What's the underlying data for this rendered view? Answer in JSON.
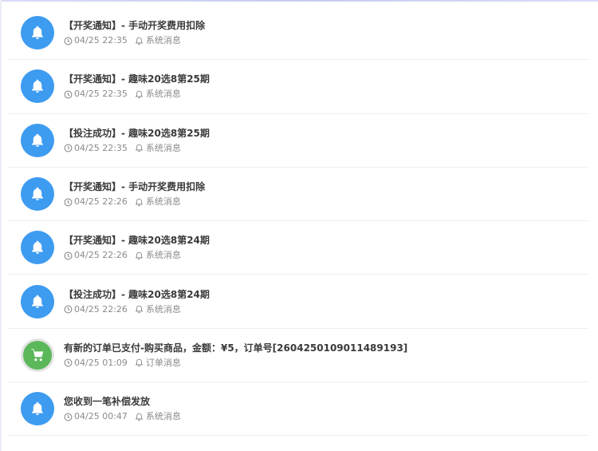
{
  "notifications": [
    {
      "title": "【开奖通知】- 手动开奖费用扣除",
      "time": "04/25 22:35",
      "category": "系统消息",
      "icon": "bell-icon"
    },
    {
      "title": "【开奖通知】- 趣味20选8第25期",
      "time": "04/25 22:35",
      "category": "系统消息",
      "icon": "bell-icon"
    },
    {
      "title": "【投注成功】- 趣味20选8第25期",
      "time": "04/25 22:35",
      "category": "系统消息",
      "icon": "bell-icon"
    },
    {
      "title": "【开奖通知】- 手动开奖费用扣除",
      "time": "04/25 22:26",
      "category": "系统消息",
      "icon": "bell-icon"
    },
    {
      "title": "【开奖通知】- 趣味20选8第24期",
      "time": "04/25 22:26",
      "category": "系统消息",
      "icon": "bell-icon"
    },
    {
      "title": "【投注成功】- 趣味20选8第24期",
      "time": "04/25 22:26",
      "category": "系统消息",
      "icon": "bell-icon"
    },
    {
      "title": "有新的订单已支付-购买商品，金额：¥5，订单号[2604250109011489193]",
      "time": "04/25 01:09",
      "category": "订单消息",
      "icon": "cart-icon"
    },
    {
      "title": "您收到一笔补偿发放",
      "time": "04/25 00:47",
      "category": "系统消息",
      "icon": "bell-icon"
    }
  ],
  "colors": {
    "bell_bg": "#3d9bf0",
    "cart_bg": "#5ab85a",
    "meta_text": "#8a8a8a",
    "title_text": "#3a3a3a"
  }
}
